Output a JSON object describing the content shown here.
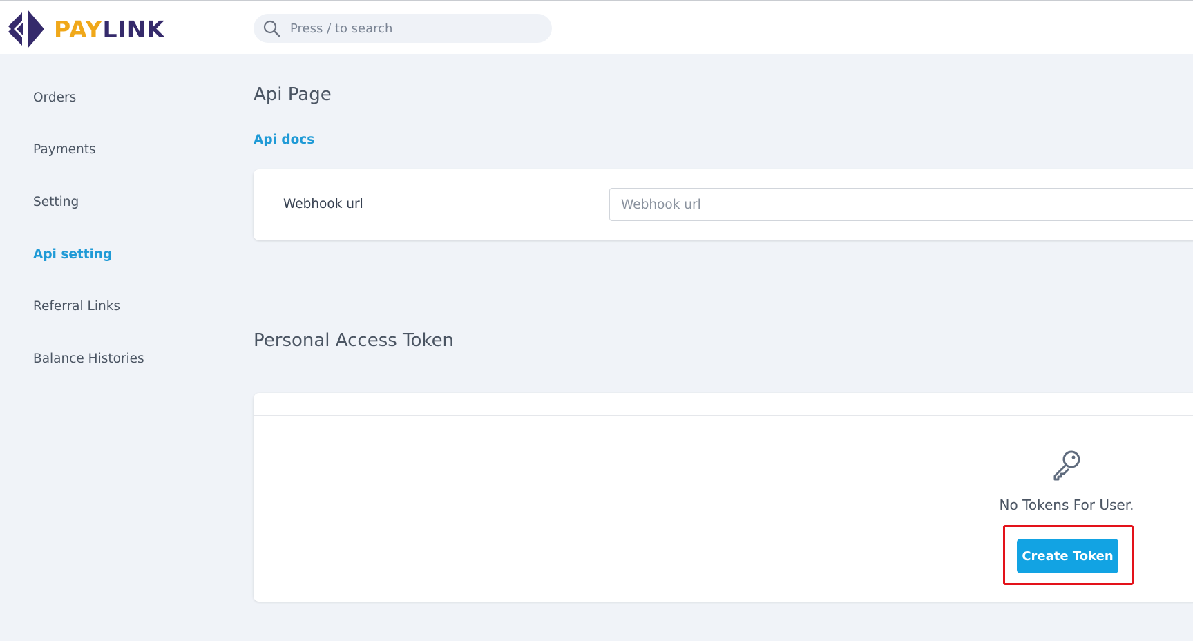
{
  "brand": {
    "part1": "PAY",
    "part2": "LINK",
    "accent_color": "#f0a81a",
    "dark_color": "#352a6b"
  },
  "search": {
    "placeholder": "Press / to search",
    "icon": "search-icon"
  },
  "sidebar": {
    "items": [
      {
        "label": "Orders",
        "active": false
      },
      {
        "label": "Payments",
        "active": false
      },
      {
        "label": "Setting",
        "active": false
      },
      {
        "label": "Api setting",
        "active": true
      },
      {
        "label": "Referral Links",
        "active": false
      },
      {
        "label": "Balance Histories",
        "active": false
      }
    ],
    "active_color": "#1f9ad6"
  },
  "main": {
    "title": "Api Page",
    "docs_link": "Api docs",
    "webhook": {
      "label": "Webhook url",
      "placeholder": "Webhook url",
      "value": ""
    },
    "tokens": {
      "title": "Personal Access Token",
      "empty_icon": "key-icon",
      "empty_text": "No Tokens For User.",
      "create_button": "Create Token",
      "button_color": "#12a3e3",
      "highlight_color": "#e3121a"
    }
  }
}
